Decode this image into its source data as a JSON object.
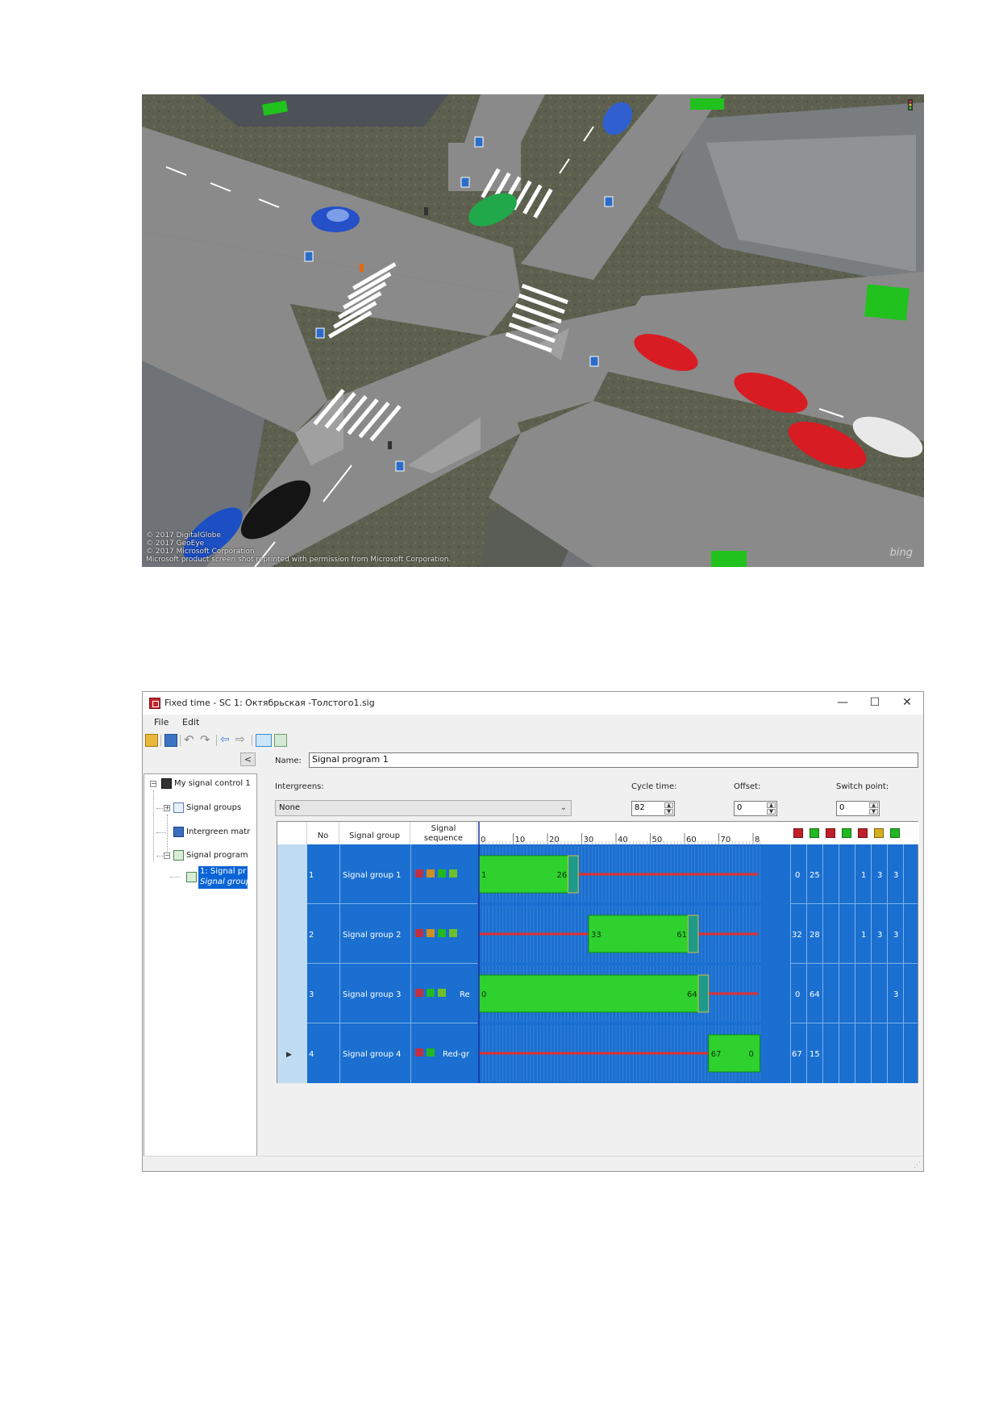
{
  "scene": {
    "credits": [
      "© 2017 DigitalGlobe",
      "© 2017 GeoEye",
      "© 2017 Microsoft Corporation",
      "Microsoft product screen shot reprinted with permission from Microsoft Corporation."
    ],
    "bing_logo": "bing"
  },
  "window": {
    "title": "Fixed time - SC 1: Октябрьская -Толстого1.sig",
    "controls": [
      "—",
      "☐",
      "✕"
    ]
  },
  "menu": [
    "File",
    "Edit"
  ],
  "toolbar_icons": [
    "exit-icon",
    "save-icon",
    "undo-icon",
    "redo-icon",
    "back-icon",
    "forward-icon",
    "view-signal-groups-icon",
    "view-program-icon"
  ],
  "tree": {
    "collapse_label": "<",
    "root": "My signal control 1",
    "items": [
      "Signal groups",
      "Intergreen matr",
      "Signal program"
    ],
    "child_line1": "1: Signal pr",
    "child_line2": "Signal group"
  },
  "form": {
    "name_label": "Name:",
    "name_value": "Signal program 1",
    "intergreens_label": "Intergreens:",
    "intergreens_value": "None",
    "cycle_label": "Cycle time:",
    "cycle_value": "82",
    "offset_label": "Offset:",
    "offset_value": "0",
    "switch_label": "Switch point:",
    "switch_value": "0"
  },
  "grid": {
    "headers": {
      "no": "No",
      "group": "Signal group",
      "sequence_line1": "Signal",
      "sequence_line2": "sequence"
    },
    "axis_ticks": [
      "0",
      "10",
      "20",
      "30",
      "40",
      "50",
      "60",
      "70",
      "8"
    ],
    "rows": [
      {
        "no": "1",
        "name": "Signal group 1",
        "seq_text": "",
        "start": "1",
        "end": "26",
        "col_red": "0",
        "col_green": "25",
        "col_a": "1",
        "col_b": "3",
        "col_c": "3"
      },
      {
        "no": "2",
        "name": "Signal group 2",
        "seq_text": "",
        "start": "33",
        "end": "61",
        "col_red": "32",
        "col_green": "28",
        "col_a": "1",
        "col_b": "3",
        "col_c": "3"
      },
      {
        "no": "3",
        "name": "Signal group 3",
        "seq_text": "Re",
        "start": "0",
        "end": "64",
        "col_red": "0",
        "col_green": "64",
        "col_a": "",
        "col_b": "",
        "col_c": "3"
      },
      {
        "no": "4",
        "name": "Signal group 4",
        "seq_text": "Red-gr",
        "start": "67",
        "end": "0",
        "col_red": "67",
        "col_green": "15",
        "col_a": "",
        "col_b": "",
        "col_c": ""
      }
    ],
    "timeline": {
      "cycle": 82,
      "bars": [
        {
          "green_from": 0,
          "green_to": 26,
          "amber_to": 29
        },
        {
          "green_from": 32,
          "green_to": 61,
          "amber_to": 64
        },
        {
          "green_from": 0,
          "green_to": 64,
          "amber_to": 67
        },
        {
          "green_from": 67,
          "green_to": 82,
          "amber_to": 82
        }
      ]
    },
    "current_row_marker": "▶"
  },
  "colors": {
    "row_blue": "#1a6fd0",
    "green": "#2ed12e",
    "red_line": "#e03030"
  }
}
